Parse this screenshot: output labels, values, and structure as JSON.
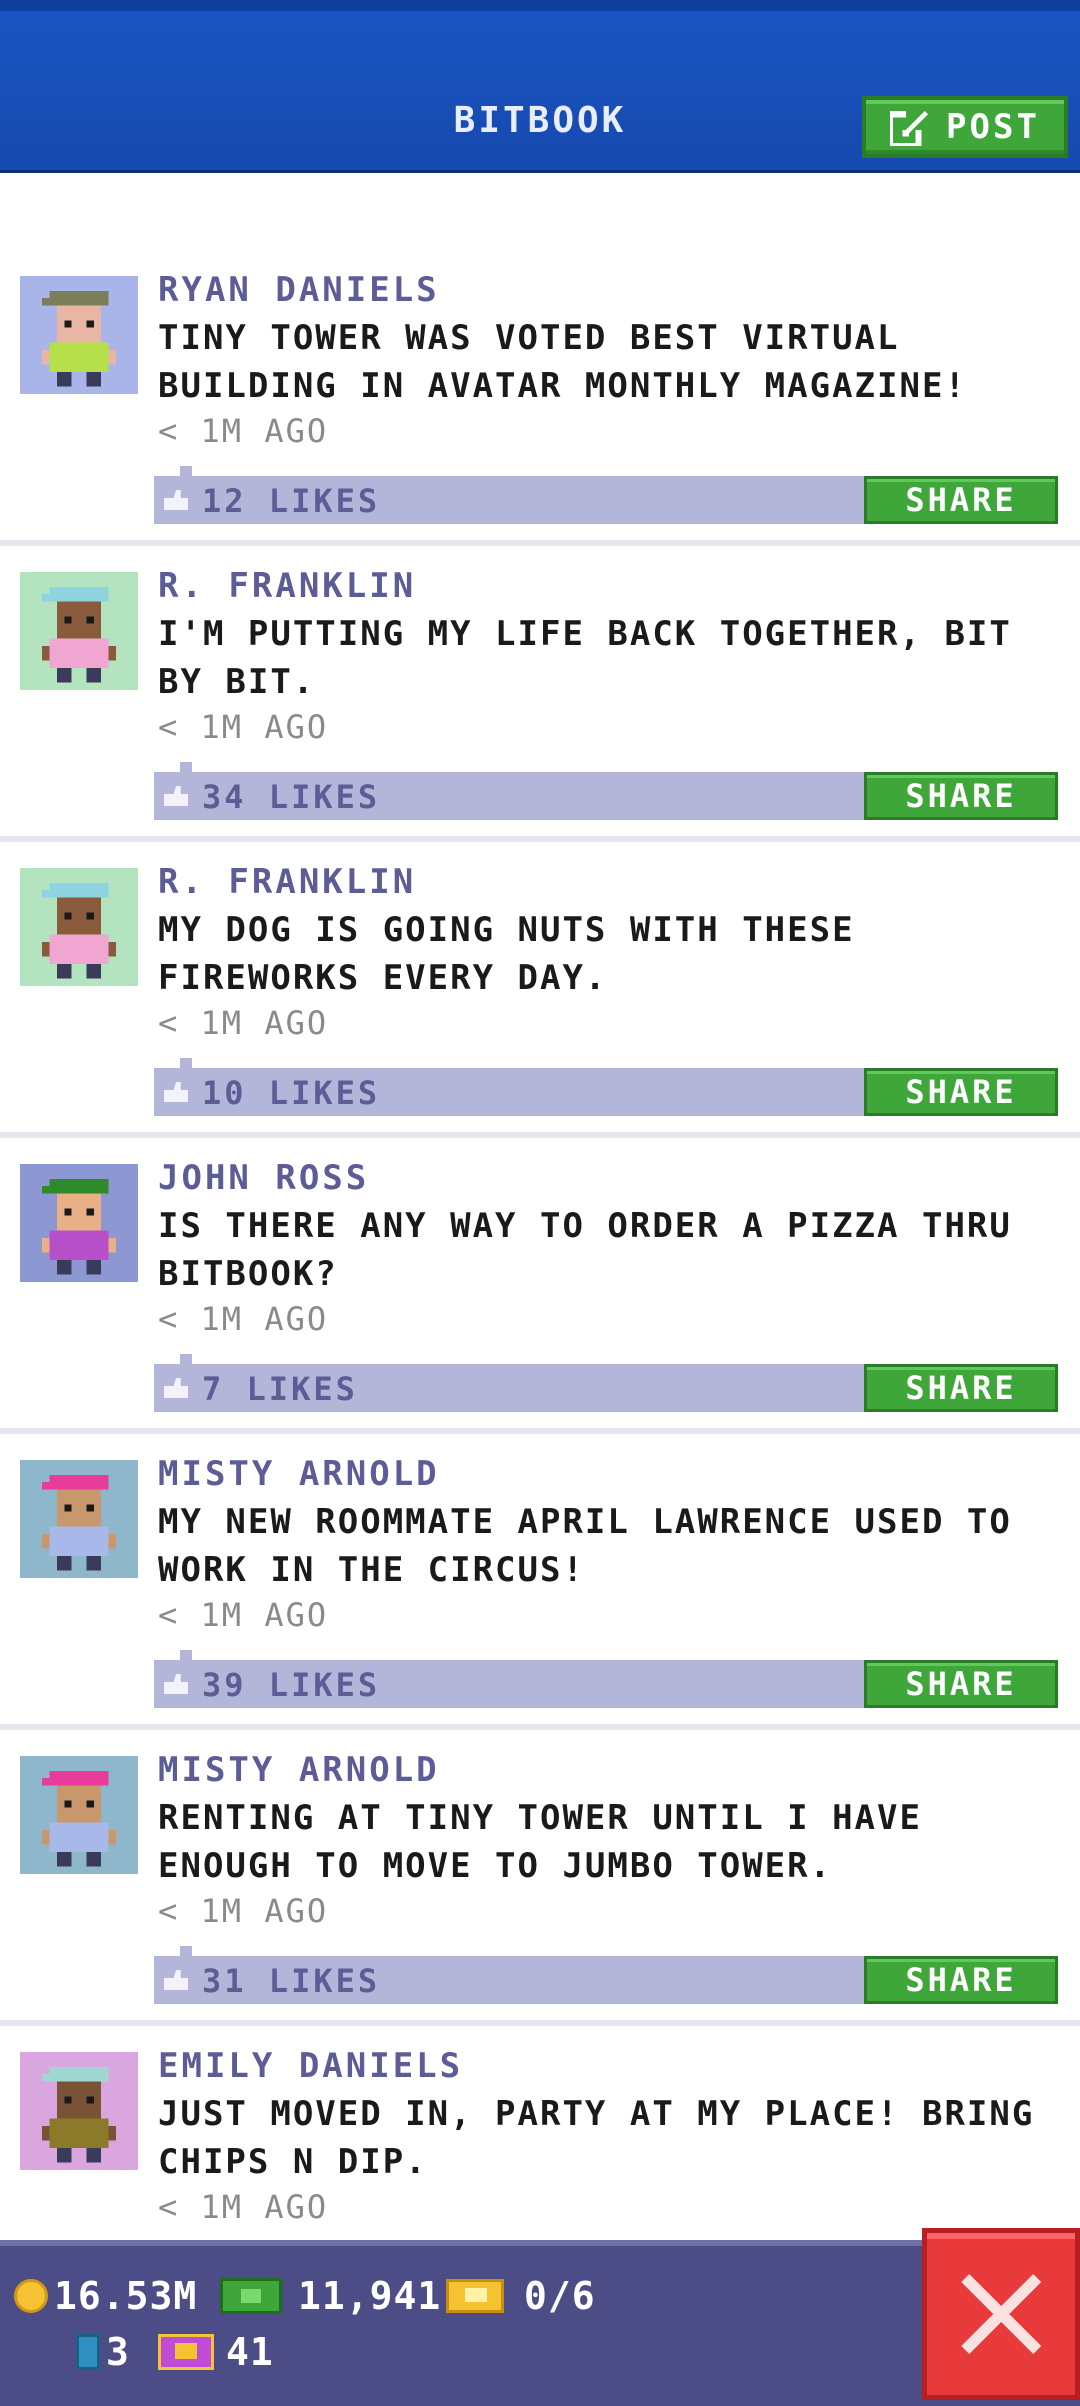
{
  "header": {
    "title": "BITBOOK",
    "post_label": "POST"
  },
  "posts": [
    {
      "author": "RYAN DANIELS",
      "message": "TINY TOWER WAS VOTED BEST VIRTUAL BUILDING IN AVATAR MONTHLY MAGAZINE!",
      "time": "< 1M AGO",
      "likes": "12 LIKES",
      "share_label": "SHARE",
      "avatar_bg": "#a9b4e8",
      "hat_color": "#7a7f5a",
      "shirt_color": "#b6e04a",
      "skin_color": "#e9b6a6"
    },
    {
      "author": "R. FRANKLIN",
      "message": "I'M PUTTING MY LIFE BACK TOGETHER, BIT BY BIT.",
      "time": "< 1M AGO",
      "likes": "34 LIKES",
      "share_label": "SHARE",
      "avatar_bg": "#b3e3bf",
      "hat_color": "#8ed3e0",
      "shirt_color": "#f0a6d0",
      "skin_color": "#8a5a3c"
    },
    {
      "author": "R. FRANKLIN",
      "message": "MY DOG IS GOING NUTS WITH THESE FIREWORKS EVERY DAY.",
      "time": "< 1M AGO",
      "likes": "10 LIKES",
      "share_label": "SHARE",
      "avatar_bg": "#b3e3bf",
      "hat_color": "#8ed3e0",
      "shirt_color": "#f0a6d0",
      "skin_color": "#8a5a3c"
    },
    {
      "author": "JOHN ROSS",
      "message": "IS THERE ANY WAY TO ORDER A PIZZA THRU BITBOOK?",
      "time": "< 1M AGO",
      "likes": "7 LIKES",
      "share_label": "SHARE",
      "avatar_bg": "#8d98d3",
      "hat_color": "#2f8a2c",
      "shirt_color": "#b64fc8",
      "skin_color": "#e9b088"
    },
    {
      "author": "MISTY ARNOLD",
      "message": "MY NEW ROOMMATE APRIL LAWRENCE USED TO WORK IN THE CIRCUS!",
      "time": "< 1M AGO",
      "likes": "39 LIKES",
      "share_label": "SHARE",
      "avatar_bg": "#8eb7cc",
      "hat_color": "#e83c9c",
      "shirt_color": "#a8b8e8",
      "skin_color": "#c9976c"
    },
    {
      "author": "MISTY ARNOLD",
      "message": "RENTING AT TINY TOWER UNTIL I HAVE ENOUGH TO MOVE TO JUMBO TOWER.",
      "time": "< 1M AGO",
      "likes": "31 LIKES",
      "share_label": "SHARE",
      "avatar_bg": "#8eb7cc",
      "hat_color": "#e83c9c",
      "shirt_color": "#a8b8e8",
      "skin_color": "#c9976c"
    },
    {
      "author": "EMILY DANIELS",
      "message": "JUST MOVED IN, PARTY AT MY PLACE! BRING CHIPS N DIP.",
      "time": "< 1M AGO",
      "likes": "",
      "share_label": "",
      "avatar_bg": "#d9a6df",
      "hat_color": "#9fd8d0",
      "shirt_color": "#8a7a2a",
      "skin_color": "#7a5236"
    }
  ],
  "status": {
    "coins": "16.53M",
    "cash": "11,941",
    "tickets": "0/6",
    "bux_items": "3",
    "bitbux": "41"
  },
  "colors": {
    "header_blue": "#1649ad",
    "accent_green": "#3fa73a",
    "like_bar": "#b3b6d9",
    "author_purple": "#5c5c96",
    "close_red": "#e8393b",
    "bottom_bar": "#4c4d86"
  },
  "icons": {
    "post": "edit-icon",
    "like": "thumb-icon",
    "close": "close-icon",
    "coin": "coin-icon",
    "cash": "cash-icon",
    "ticket": "ticket-icon"
  }
}
